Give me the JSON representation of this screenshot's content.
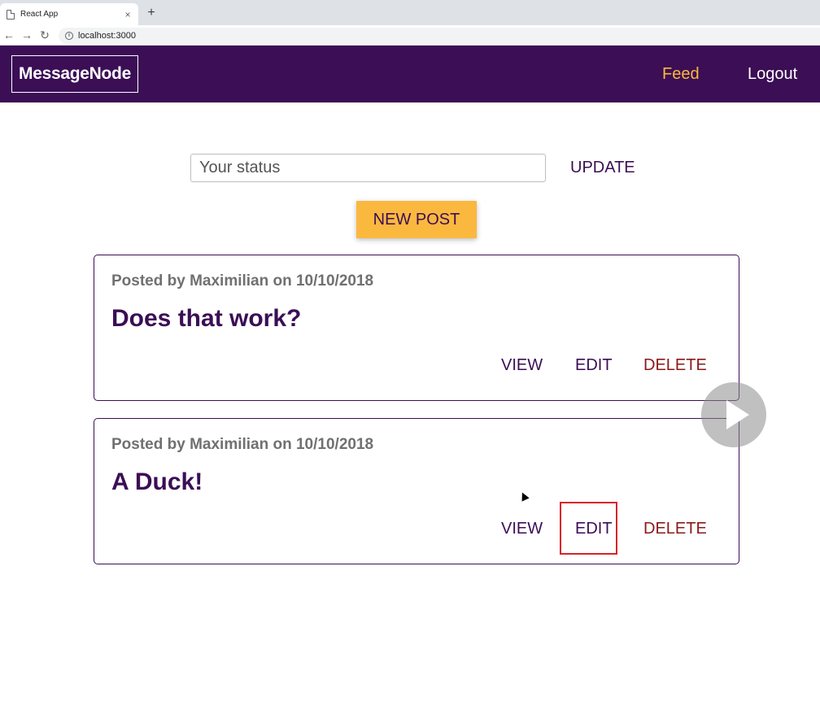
{
  "browser": {
    "tab_title": "React App",
    "tab_close": "×",
    "new_tab": "+",
    "back": "←",
    "forward": "→",
    "reload": "↻",
    "info": "i",
    "url": "localhost:3000"
  },
  "header": {
    "logo": "MessageNode",
    "nav": {
      "feed": "Feed",
      "logout": "Logout"
    }
  },
  "status": {
    "placeholder": "Your status",
    "value": "",
    "update_label": "UPDATE"
  },
  "new_post_label": "NEW POST",
  "posts": [
    {
      "meta": "Posted by Maximilian on 10/10/2018",
      "title": "Does that work?",
      "view": "VIEW",
      "edit": "EDIT",
      "delete": "DELETE"
    },
    {
      "meta": "Posted by Maximilian on 10/10/2018",
      "title": "A Duck!",
      "view": "VIEW",
      "edit": "EDIT",
      "delete": "DELETE"
    }
  ],
  "colors": {
    "brand": "#3b0e55",
    "accent": "#fab83f",
    "danger": "#8a1b1b",
    "highlight": "#d9232a"
  },
  "icons": {
    "play_overlay": "play-icon",
    "cursor": "mouse-cursor-icon"
  }
}
